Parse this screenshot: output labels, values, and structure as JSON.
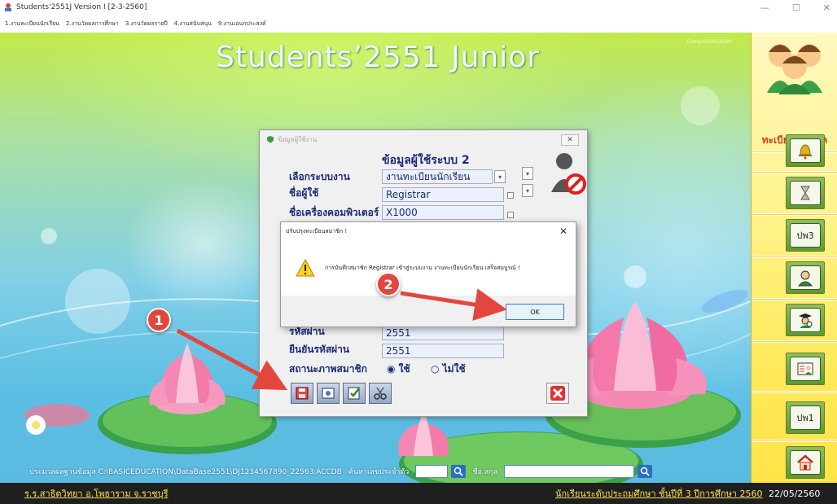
{
  "window": {
    "title": "Students'2551J Version I [2-3-2560]",
    "minimize": "—",
    "maximize": "☐",
    "close": "✕"
  },
  "menu": {
    "items": [
      "1.งานทะเบียนนักเรียน",
      "2.งานวัดผลการศึกษา",
      "3.งานวัดผลรายปี",
      "4.งานสนับสนุน",
      "9.งานเอนกประสงค์"
    ]
  },
  "main": {
    "title": "Students’2551 Junior",
    "comp_label": "Comp:05/05/2560"
  },
  "sidebar": {
    "group_label": "ทะเบียน&วัดผล",
    "buttons": [
      {
        "icon": "bell-icon",
        "label": ""
      },
      {
        "icon": "hourglass-icon",
        "label": ""
      },
      {
        "icon": "document-pw3-icon",
        "label": "ปพ3"
      },
      {
        "icon": "student-icon",
        "label": ""
      },
      {
        "icon": "graduate-search-icon",
        "label": ""
      },
      {
        "icon": "id-card-icon",
        "label": ""
      },
      {
        "icon": "document-pw1-icon",
        "label": "ปพ1"
      },
      {
        "icon": "home-icon",
        "label": ""
      }
    ]
  },
  "user_dialog": {
    "title": "ข้อมูลผู้ใช้งาน",
    "close": "✕",
    "heading": "ข้อมูลผู้ใช้ระบบ 2",
    "labels": {
      "system": "เลือกระบบงาน",
      "username": "ชื่อผู้ใช้",
      "computer": "ชื่อเครื่องคอมพิวเตอร์",
      "password": "รหัสผ่าน",
      "confirm": "ยืนยันรหัสผ่าน",
      "status": "สถานะภาพสมาชิก"
    },
    "values": {
      "system": "งานทะเบียนนักเรียน",
      "username": "Registrar",
      "computer": "X1000",
      "password": "2551",
      "confirm": "2551"
    },
    "status_options": [
      "◉ ใช้",
      "○ ไม่ใช้"
    ]
  },
  "message_box": {
    "title": "ปรับปรุงทะเบียนสมาชิก !",
    "close": "✕",
    "message": "การบันทึกสมาชิก Registrar เข้าสู่ระบบงาน งานทะเบียนนักเรียน เสร็จสมบูรณ์ !",
    "ok_label": "OK"
  },
  "bottom": {
    "path_label": "ประมวลผลฐานข้อมูล C:\\BASICEDUCATION\\DataBase2551\\DJ1234567890_22563.ACCDB",
    "id_label": "ค้นหาเลขประจำตัว",
    "name_label": "ชื่อ สกุล"
  },
  "status": {
    "school": "ร.ร.สาธิตวิทยา อ.โพธาราม จ.ราชบุรี",
    "level": "นักเรียนระดับประถมศึกษา ชั้นปีที่ 3 ปีการศึกษา 2560",
    "date": "22/05/2560"
  },
  "annotations": {
    "step1": "1",
    "step2": "2"
  }
}
